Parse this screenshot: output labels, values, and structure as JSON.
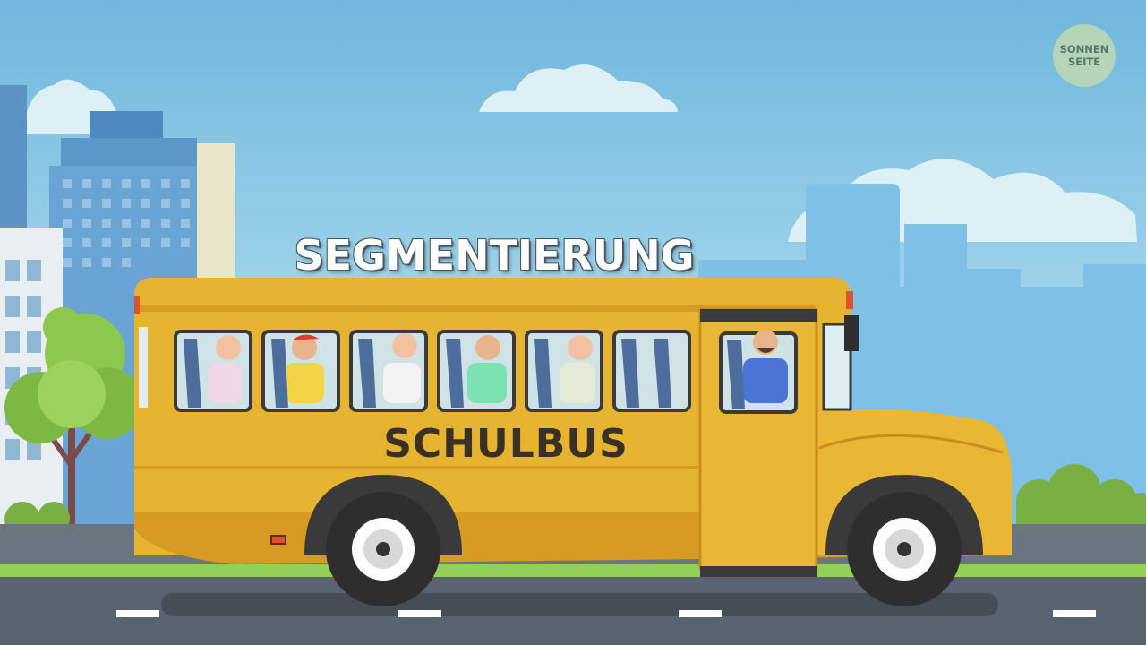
{
  "video": {
    "headline": "SEGMENTIERUNG",
    "bus_label": "SCHULBUS"
  },
  "logo": {
    "line1": "SONNEN",
    "line2": "SEITE"
  },
  "colors": {
    "sky": "#8fcbe6",
    "bus_yellow": "#e7b431",
    "bus_orange": "#d79a22",
    "road": "#5a6470",
    "grass": "#93d05a"
  }
}
